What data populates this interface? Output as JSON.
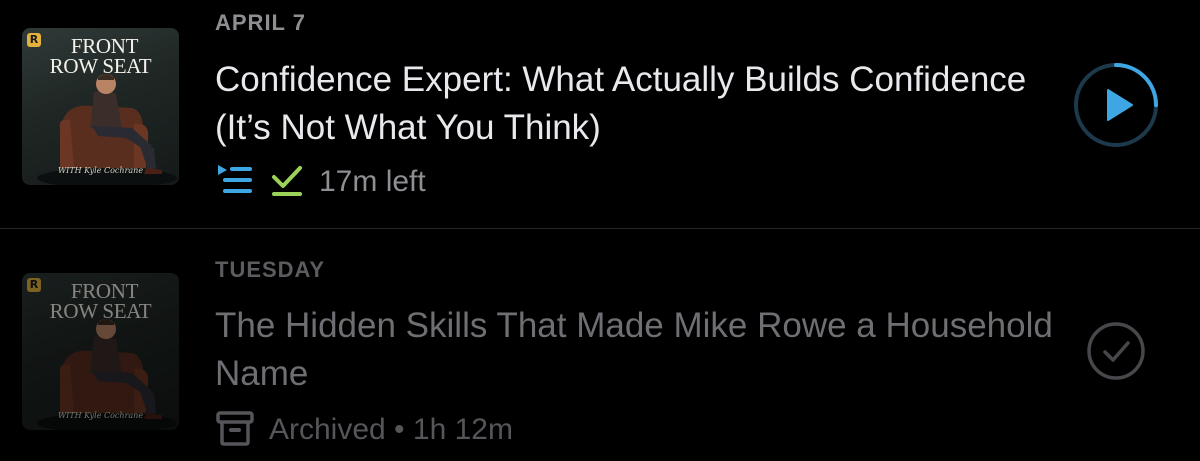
{
  "episodes": [
    {
      "date": "APRIL 7",
      "title": "Confidence Expert: What Actually Builds Confidence (It’s Not What You Think)",
      "status_text": "17m left",
      "artwork": {
        "badge": "R",
        "line1": "FRONT",
        "line2": "ROW SEAT",
        "signature": "WITH Kyle Cochrane"
      },
      "icons": [
        "queue-icon",
        "downloaded-check-icon",
        "play-icon"
      ],
      "played_fraction": 0.25,
      "colors": {
        "accent": "#3ea6e3",
        "downloaded": "#9bd35a"
      }
    },
    {
      "date": "TUESDAY",
      "title": "The Hidden Skills That Made Mike Rowe a Household Name",
      "status_text": "Archived • 1h 12m",
      "artwork": {
        "badge": "R",
        "line1": "FRONT",
        "line2": "ROW SEAT",
        "signature": "WITH Kyle Cochrane"
      },
      "icons": [
        "archive-icon",
        "played-check-icon"
      ]
    }
  ]
}
